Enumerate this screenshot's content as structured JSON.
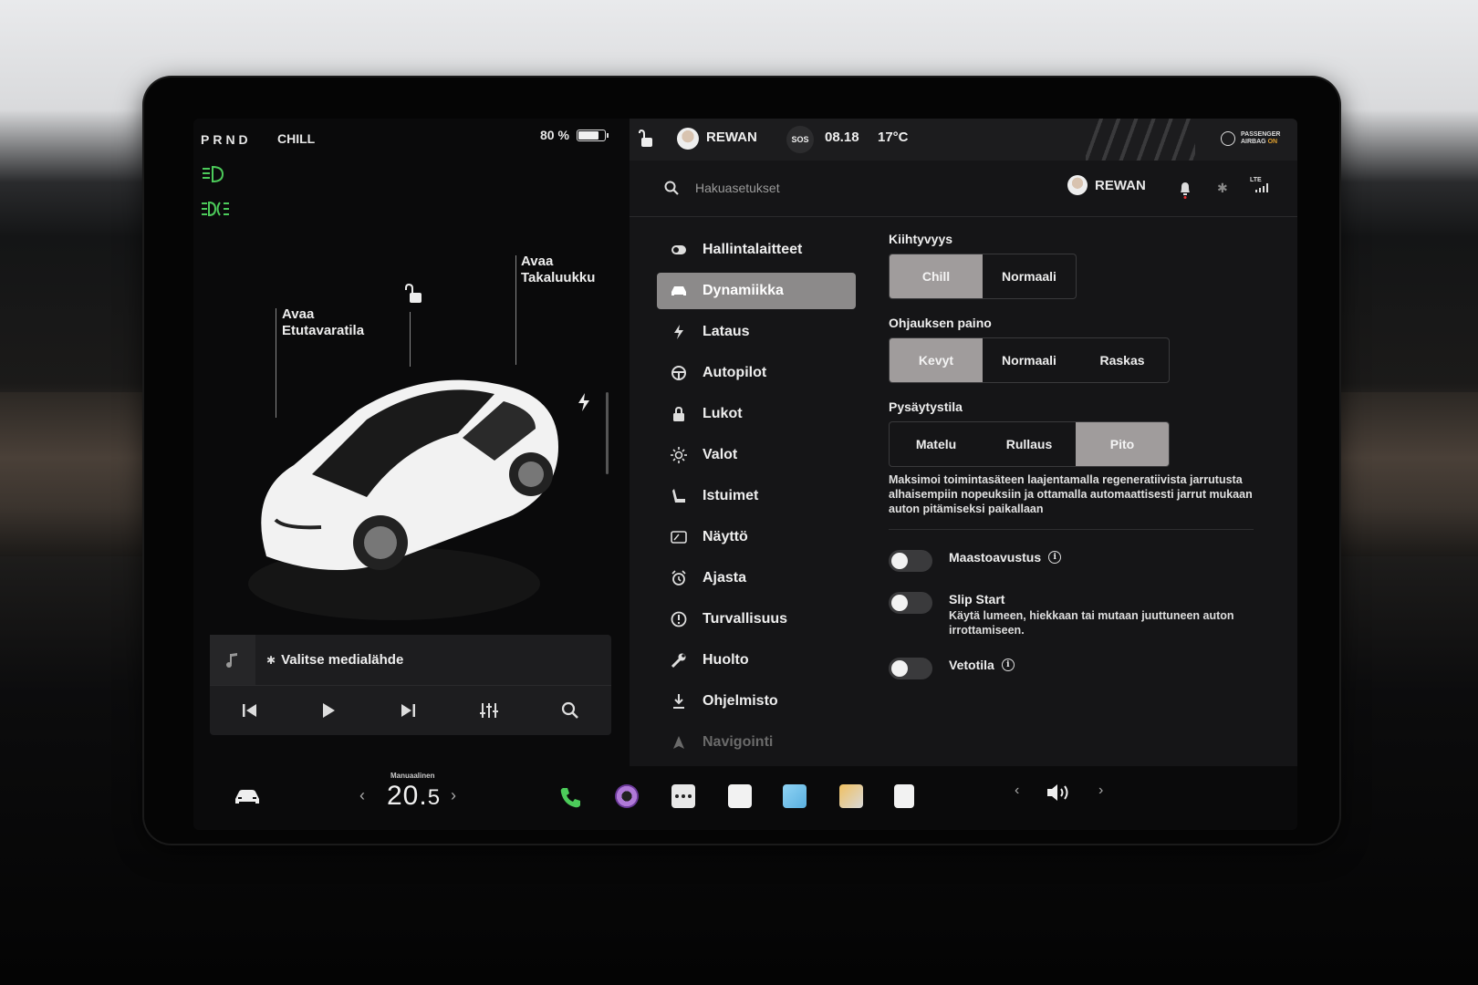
{
  "drive": {
    "gears": "PRND",
    "mode": "CHILL",
    "battery_text": "80 %",
    "battery_level": 0.8
  },
  "car_view": {
    "frunk_label": "Avaa\nEtutavaratila",
    "trunk_label": "Avaa\nTakaluukku"
  },
  "media": {
    "source_label": "Valitse medialähde"
  },
  "status_bar": {
    "user": "REWAN",
    "sos": "SOS",
    "time": "08.18",
    "temperature": "17°C",
    "airbag_line1": "PASSENGER",
    "airbag_line2a": "AIRBAG ",
    "airbag_line2b": "ON"
  },
  "settings_header": {
    "search_placeholder": "Hakuasetukset",
    "user": "REWAN",
    "network": "LTE"
  },
  "menu": {
    "items": [
      {
        "label": "Hallintalaitteet",
        "icon": "toggle-icon"
      },
      {
        "label": "Dynamiikka",
        "icon": "car-icon"
      },
      {
        "label": "Lataus",
        "icon": "bolt-icon"
      },
      {
        "label": "Autopilot",
        "icon": "steering-wheel-icon"
      },
      {
        "label": "Lukot",
        "icon": "lock-icon"
      },
      {
        "label": "Valot",
        "icon": "sun-icon"
      },
      {
        "label": "Istuimet",
        "icon": "seat-icon"
      },
      {
        "label": "Näyttö",
        "icon": "display-icon"
      },
      {
        "label": "Ajasta",
        "icon": "alarm-icon"
      },
      {
        "label": "Turvallisuus",
        "icon": "alert-icon"
      },
      {
        "label": "Huolto",
        "icon": "wrench-icon"
      },
      {
        "label": "Ohjelmisto",
        "icon": "download-icon"
      },
      {
        "label": "Navigointi",
        "icon": "navigation-icon"
      }
    ],
    "active_index": 1
  },
  "dynamics": {
    "acceleration": {
      "title": "Kiihtyvyys",
      "options": [
        "Chill",
        "Normaali"
      ],
      "selected": "Chill"
    },
    "steering": {
      "title": "Ohjauksen paino",
      "options": [
        "Kevyt",
        "Normaali",
        "Raskas"
      ],
      "selected": "Kevyt"
    },
    "stopping": {
      "title": "Pysäytystila",
      "options": [
        "Matelu",
        "Rullaus",
        "Pito"
      ],
      "selected": "Pito",
      "description": "Maksimoi toimintasäteen laajentamalla regeneratiivista jarrutusta alhaisempiin nopeuksiin ja ottamalla automaattisesti jarrut mukaan auton pitämiseksi paikallaan"
    },
    "toggles": [
      {
        "label": "Maastoavustus",
        "info": true,
        "on": false,
        "sub": ""
      },
      {
        "label": "Slip Start",
        "info": false,
        "on": false,
        "sub": "Käytä lumeen, hiekkaan tai mutaan juuttuneen auton irrottamiseen."
      },
      {
        "label": "Vetotila",
        "info": true,
        "on": false,
        "sub": ""
      }
    ]
  },
  "dock": {
    "climate_mode": "Manuaalinen",
    "temp_whole": "20.",
    "temp_decimal": "5",
    "info_glyph": "i"
  },
  "colors": {
    "accent_green": "#4ccb5a",
    "selected_segment": "#a09c9c",
    "active_menu": "#8c8a8a",
    "airbag_on": "#e0a030"
  }
}
